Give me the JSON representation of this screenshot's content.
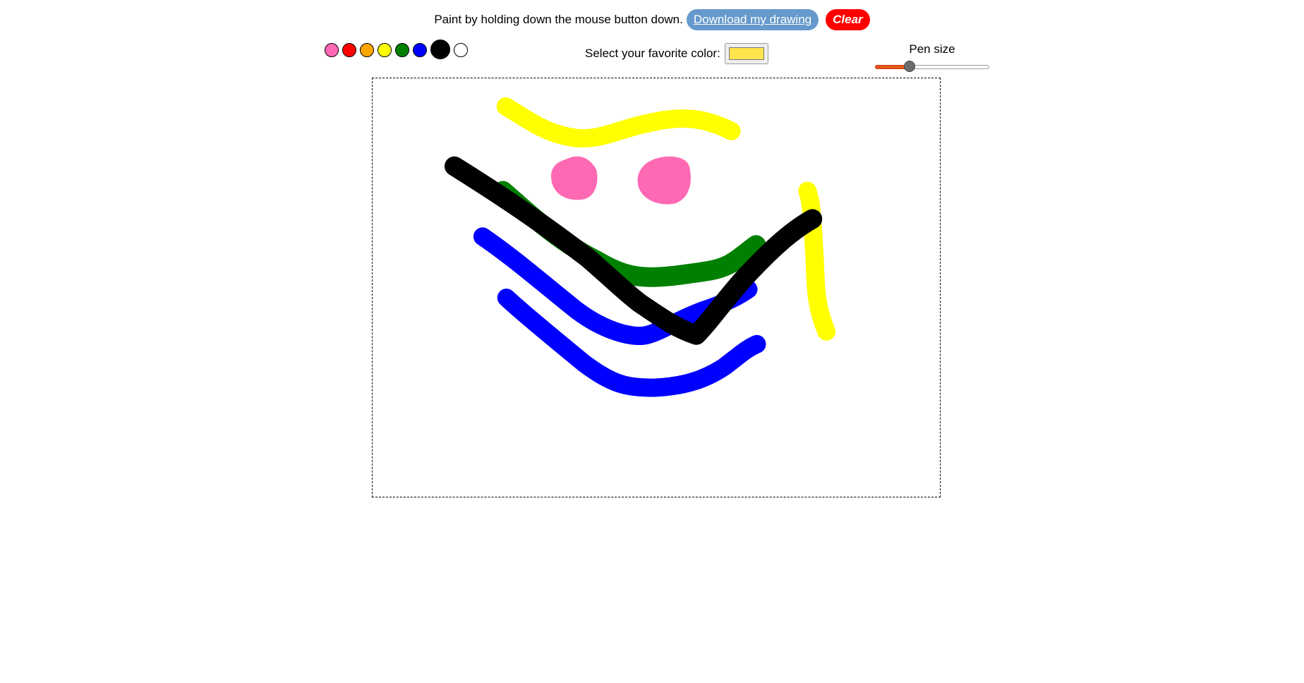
{
  "header": {
    "instruction": "Paint by holding down the mouse button down.",
    "download_label": "Download my drawing",
    "clear_label": "Clear"
  },
  "palette": {
    "colors": [
      "#ff69b4",
      "#ff0000",
      "#ffa500",
      "#ffff00",
      "#008000",
      "#0000ff",
      "#000000",
      "#ffffff"
    ],
    "selected": "#000000"
  },
  "favorite_color": {
    "label": "Select your favorite color:",
    "value": "#ffe44d"
  },
  "pen_size": {
    "label": "Pen size",
    "value_fraction": 0.3
  }
}
